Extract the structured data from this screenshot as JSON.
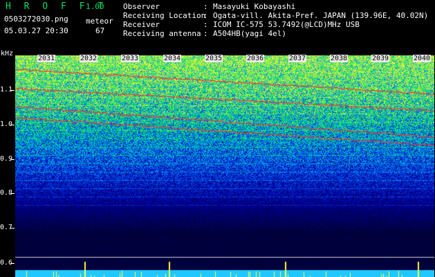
{
  "header": {
    "app_name": "H R O F F T",
    "version": "1.00",
    "filename": "0503272030.png",
    "datetime": "05.03.27 20:30",
    "meteor_label": "meteor",
    "meteor_count": "67"
  },
  "info": {
    "observer_label": "Observer",
    "observer_value": "Masayuki Kobayashi",
    "location_label": "Receiving Location",
    "location_value": "Ogata-vill. Akita-Pref. JAPAN (139.96E, 40.02N)",
    "receiver_label": "Receiver",
    "receiver_value": "ICOM IC-575 53.7492(@LCD)MHz USB",
    "antenna_label": "Receiving antenna",
    "antenna_value": "A504HB(yagi 4el)",
    "separator": ":"
  },
  "axis": {
    "unit": "kHz",
    "y_labels": [
      "1.1",
      "1.0",
      "0.9",
      "0.8",
      "0.7",
      "0.6"
    ],
    "x_labels": [
      "2031",
      "2032",
      "2033",
      "2034",
      "2035",
      "2036",
      "2037",
      "2038",
      "2039",
      "2040"
    ]
  },
  "colors": {
    "background": "#000000",
    "app_name": "#00e060",
    "text": "#ffffff",
    "trace": "#ff3030",
    "meteor_bar": "#ffff40"
  }
}
